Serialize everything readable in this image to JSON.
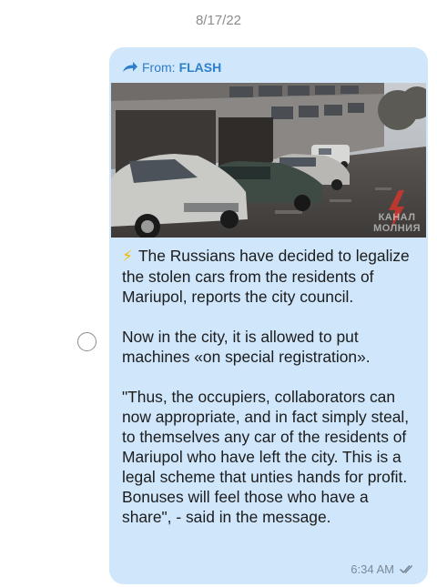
{
  "date_header": "8/17/22",
  "message": {
    "forwarded_prefix": "From:",
    "forwarded_source": "FLASH",
    "emoji": "⚡",
    "paragraphs": [
      "The Russians have decided to legalize the stolen cars from the residents of Mariupol, reports the city council.",
      "Now in the city, it is allowed to put machines «on special registration».",
      "\"Thus, the occupiers, collaborators can now appropriate, and in fact simply steal, to themselves any car of the residents of Mariupol who have left the city. This is a legal scheme that unties hands for profit. Bonuses will feel those who have a share\", - said in the message."
    ],
    "time": "6:34 AM",
    "status_icon": "double-check-icon",
    "photo_watermark_line1": "КАНАЛ",
    "photo_watermark_line2": "МОЛНИЯ"
  },
  "colors": {
    "bubble_bg": "#cfe6fb",
    "forward_blue": "#2f7fc9",
    "time_gray": "#7a8a99",
    "emoji_yellow": "#f5b800"
  }
}
